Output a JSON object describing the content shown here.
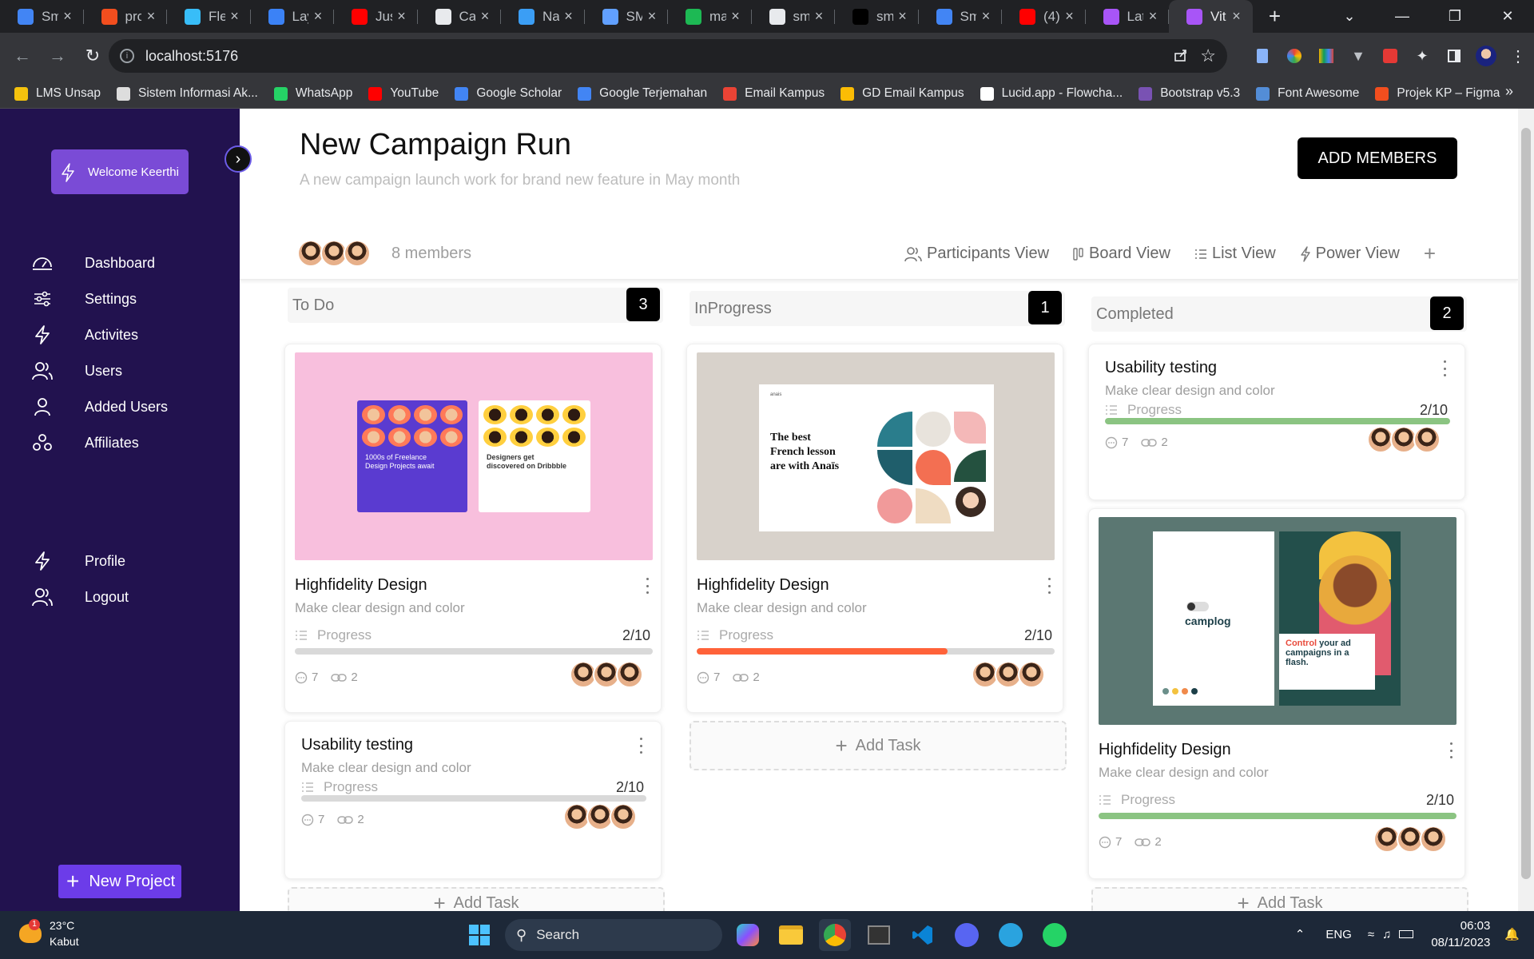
{
  "browser": {
    "tabs": [
      {
        "label": "Sm",
        "color": "#4285f4"
      },
      {
        "label": "pro",
        "color": "#f24e1e"
      },
      {
        "label": "Fle",
        "color": "#38bdf8"
      },
      {
        "label": "Lay",
        "color": "#3b82f6"
      },
      {
        "label": "Jus",
        "color": "#ff0000"
      },
      {
        "label": "Cat",
        "color": "#e8eaed"
      },
      {
        "label": "Na",
        "color": "#3b9ef5"
      },
      {
        "label": "SM",
        "color": "#61a0ff"
      },
      {
        "label": "ma",
        "color": "#1db954"
      },
      {
        "label": "sm",
        "color": "#e8eaed"
      },
      {
        "label": "sm",
        "color": "#000000"
      },
      {
        "label": "Sm",
        "color": "#4285f4"
      },
      {
        "label": "(4)",
        "color": "#ff0000"
      },
      {
        "label": "Lat",
        "color": "#a855f7"
      },
      {
        "label": "Vit",
        "color": "#a855f7"
      }
    ],
    "url": "localhost:5176",
    "bookmarks": [
      {
        "label": "LMS Unsap",
        "color": "#f4c20d"
      },
      {
        "label": "Sistem Informasi Ak...",
        "color": "#dddddd"
      },
      {
        "label": "WhatsApp",
        "color": "#25d366"
      },
      {
        "label": "YouTube",
        "color": "#ff0000"
      },
      {
        "label": "Google Scholar",
        "color": "#4285f4"
      },
      {
        "label": "Google Terjemahan",
        "color": "#4285f4"
      },
      {
        "label": "Email Kampus",
        "color": "#ea4335"
      },
      {
        "label": "GD Email Kampus",
        "color": "#fbbc04"
      },
      {
        "label": "Lucid.app - Flowcha...",
        "color": "#ffffff"
      },
      {
        "label": "Bootstrap v5.3",
        "color": "#7952b3"
      },
      {
        "label": "Font Awesome",
        "color": "#538dd7"
      },
      {
        "label": "Projek KP – Figma",
        "color": "#f24e1e"
      }
    ]
  },
  "sidebar": {
    "welcome": "Welcome Keerthi",
    "items": [
      {
        "label": "Dashboard",
        "icon": "dashboard-icon"
      },
      {
        "label": "Settings",
        "icon": "sliders-icon"
      },
      {
        "label": "Activites",
        "icon": "bolt-icon"
      },
      {
        "label": "Users",
        "icon": "users-icon"
      },
      {
        "label": "Added Users",
        "icon": "user-icon"
      },
      {
        "label": "Affiliates",
        "icon": "affiliates-icon"
      }
    ],
    "bottom_items": [
      {
        "label": "Profile",
        "icon": "bolt-icon"
      },
      {
        "label": "Logout",
        "icon": "users-icon"
      }
    ],
    "new_project": "New Project"
  },
  "header": {
    "title": "New Campaign Run",
    "subtitle": "A new campaign launch work for brand new feature in May month",
    "add_members": "ADD MEMBERS",
    "members": "8 members",
    "views": [
      "Participants View",
      "Board View",
      "List View",
      "Power View"
    ],
    "add_view": "+"
  },
  "columns": [
    {
      "title": "To Do",
      "count": "3",
      "cards": [
        {
          "title": "Highfidelity Design",
          "desc": "Make clear design and color",
          "progress_label": "Progress",
          "progress": "2/10",
          "bar_fill": 0.0,
          "bar_color": "#d9d9d9",
          "comments": "7",
          "links": "2",
          "image": "pink"
        },
        {
          "title": "Usability testing",
          "desc": "Make clear design and color",
          "progress_label": "Progress",
          "progress": "2/10",
          "bar_fill": 0.0,
          "bar_color": "#d9d9d9",
          "comments": "7",
          "links": "2"
        }
      ],
      "add_task": "Add Task"
    },
    {
      "title": "InProgress",
      "count": "1",
      "cards": [
        {
          "title": "Highfidelity Design",
          "desc": "Make clear design and color",
          "progress_label": "Progress",
          "progress": "2/10",
          "bar_fill": 0.7,
          "bar_color": "#ff6239",
          "comments": "7",
          "links": "2",
          "image": "french"
        }
      ],
      "add_task": "Add Task"
    },
    {
      "title": "Completed",
      "count": "2",
      "cards": [
        {
          "title": "Usability testing",
          "desc": "Make clear design and color",
          "progress_label": "Progress",
          "progress": "2/10",
          "bar_fill": 1.0,
          "bar_color": "#8bc482",
          "comments": "7",
          "links": "2"
        },
        {
          "title": "Highfidelity Design",
          "desc": "Make clear design and color",
          "progress_label": "Progress",
          "progress": "2/10",
          "bar_fill": 1.0,
          "bar_color": "#8bc482",
          "comments": "7",
          "links": "2",
          "image": "camplog"
        }
      ],
      "add_task": "Add Task"
    }
  ],
  "images": {
    "pink": {
      "line1": "1000s of Freelance",
      "line2": "Design Projects await",
      "line3": "Designers get",
      "line4": "discovered on Dribbble"
    },
    "french": {
      "brand": "anais",
      "headline1": "The best",
      "headline2": "French lesson",
      "headline3": "are with Anaïs"
    },
    "camplog": {
      "brand": "camplog",
      "lead": "Control",
      "rest1": " your ad",
      "rest2": "campaigns in a",
      "rest3": "flash."
    }
  },
  "taskbar": {
    "temp": "23°C",
    "weather": "Kabut",
    "search": "Search",
    "lang": "ENG",
    "time": "06:03",
    "date": "08/11/2023"
  }
}
